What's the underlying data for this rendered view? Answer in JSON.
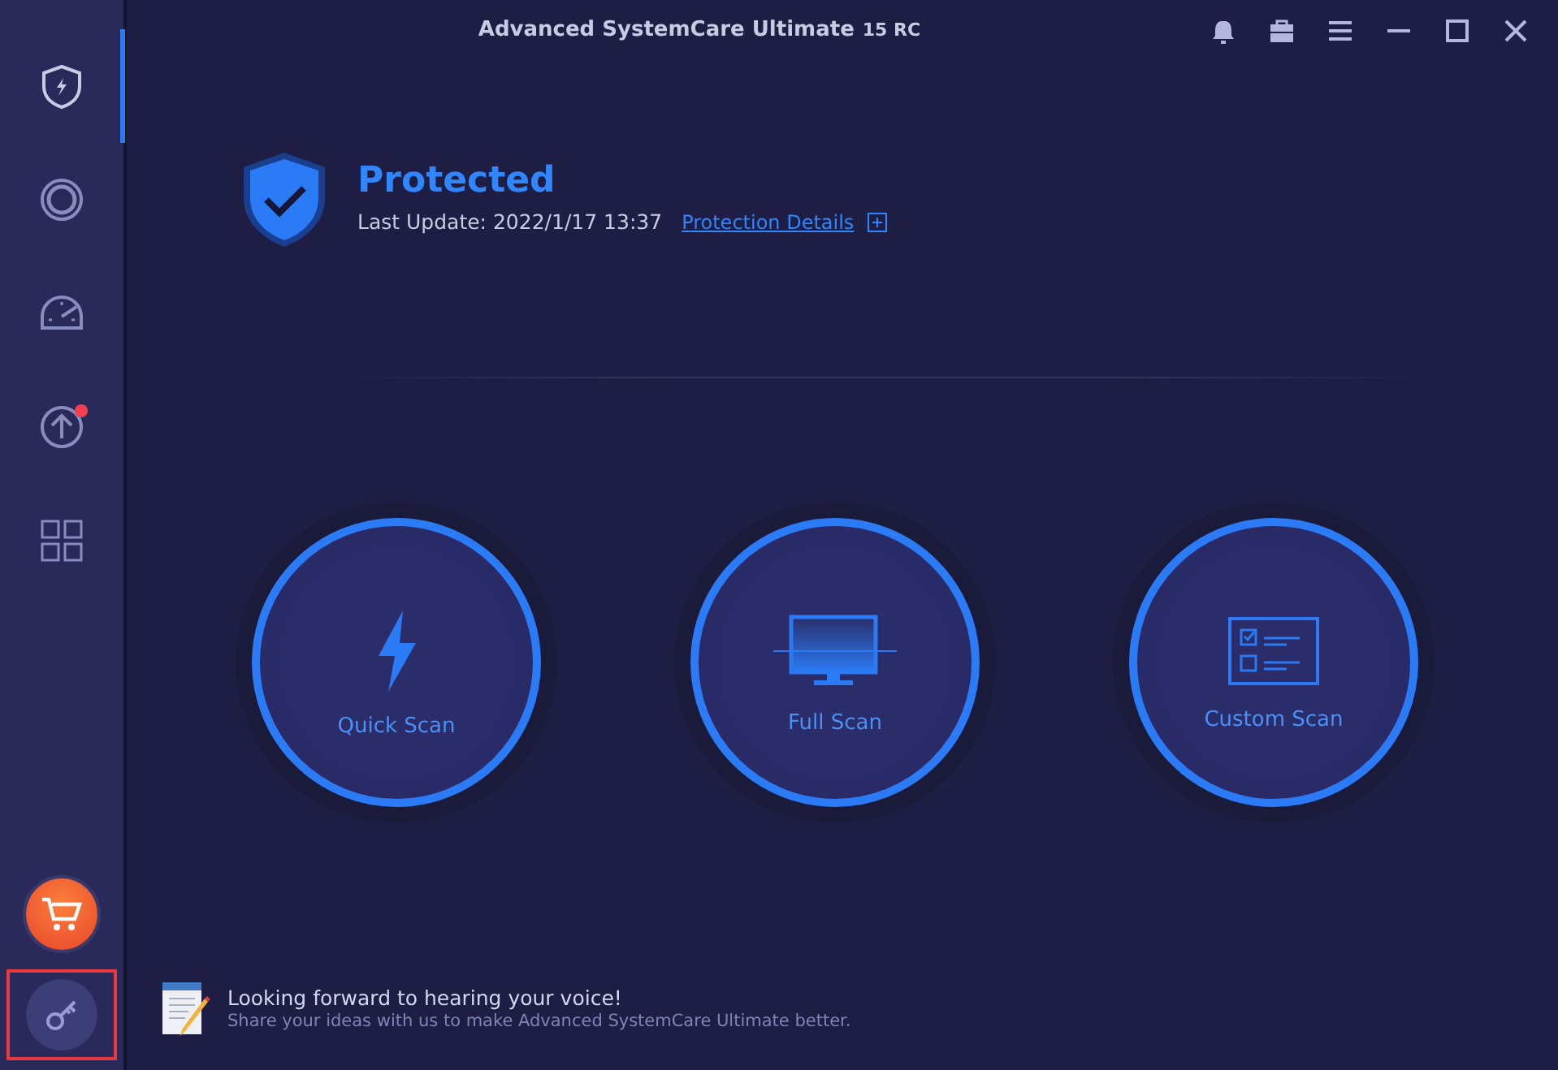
{
  "window": {
    "title": "Advanced SystemCare Ultimate",
    "version": "15 RC"
  },
  "sidebar": {
    "items": [
      {
        "kind": "shield",
        "selected": true,
        "badge": false
      },
      {
        "kind": "ring",
        "selected": false,
        "badge": false
      },
      {
        "kind": "gauge",
        "selected": false,
        "badge": false
      },
      {
        "kind": "upload",
        "selected": false,
        "badge": true
      },
      {
        "kind": "grid",
        "selected": false,
        "badge": false
      }
    ],
    "key_button": {
      "highlighted": true
    }
  },
  "status": {
    "title": "Protected",
    "last_update": "Last Update: 2022/1/17 13:37",
    "details_link": "Protection Details"
  },
  "scans": [
    {
      "kind": "quick",
      "label": "Quick Scan"
    },
    {
      "kind": "full",
      "label": "Full Scan"
    },
    {
      "kind": "custom",
      "label": "Custom Scan"
    }
  ],
  "feedback": {
    "title": "Looking forward to hearing your voice!",
    "subtitle": "Share your ideas with us to make Advanced SystemCare Ultimate better."
  }
}
